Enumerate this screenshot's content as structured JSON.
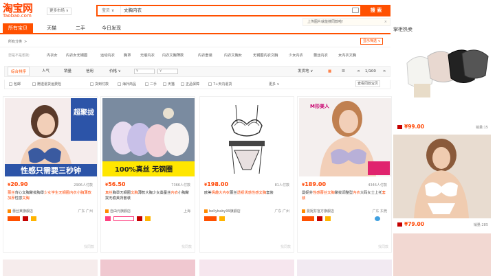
{
  "logo": {
    "cn": "淘宝网",
    "en": "Taobao.com"
  },
  "region": {
    "label": "更多市场 ∨"
  },
  "search": {
    "scope": "宝贝 ∨",
    "query": "文胸内衣",
    "button": "搜 索"
  },
  "tip": {
    "text": "上传图片就能搜同款啦!",
    "close": "×"
  },
  "nav": {
    "items": [
      {
        "label": "所有宝贝"
      },
      {
        "label": "天猫"
      },
      {
        "label": "二手"
      },
      {
        "label": "今日发现"
      }
    ]
  },
  "rightcol": {
    "title": "掌柜热卖"
  },
  "crumb": {
    "label": "所有分类",
    "arrow": ">"
  },
  "filter_button": "显示筛选 ∨",
  "attrs": {
    "label": "您是不是想找:",
    "items": [
      "内衣女",
      "内衣女无钢圈",
      "运动内衣",
      "胸罩",
      "无痕内衣",
      "内衣文胸薄款",
      "内衣套装",
      "内衣文胸女",
      "无钢圈内衣文胸",
      "少女内衣",
      "蕾丝内衣",
      "女内衣文胸"
    ]
  },
  "sortbar": {
    "items": [
      "综合排序",
      "人气",
      "销量",
      "信用",
      "价格 ∨"
    ],
    "price_from": "¥",
    "price_to": "¥",
    "ship_to": "发货地 ∨",
    "page": "1/100",
    "grid_icon": "▦",
    "list_icon": "☰",
    "prev": "<",
    "next": ">"
  },
  "checks": {
    "items": [
      "包邮",
      "赠送退货运费险",
      "货到付款",
      "海外商品",
      "二手",
      "天猫",
      "正品保障",
      "7+天内退货"
    ],
    "more": "更多 ∨",
    "global": "查看同款宝贝"
  },
  "products": [
    {
      "banner_top": "超聚拢",
      "banner_bottom": "性感只需要三秒钟",
      "price": "20.90",
      "sales": "2906人付款",
      "title": [
        "蕾丝",
        "背心文胸聚拢胸罩",
        "少女学生无钢圈内衣小胸薄款加厚",
        "性感",
        "文胸"
      ],
      "shop": "蕾丝莱旗舰店",
      "loc": "广东 广州",
      "colors": [
        "#ffb8c8",
        "#cc3366"
      ]
    },
    {
      "banner_top": "",
      "banner_bottom": "100%真丝 无钢圈",
      "price": "56.50",
      "sales": "7366人付款",
      "title": [
        "真丝",
        "胸罩无钢圈",
        "文胸",
        "薄款大胸少女桑蚕丝",
        "内衣",
        "小胸聚拢无痕美背套装"
      ],
      "shop": "自由元旗舰店",
      "loc": "上海",
      "colors": [
        "#e8d8f0",
        "#a090c0"
      ]
    },
    {
      "banner_top": "",
      "banner_bottom": "",
      "price": "198.00",
      "sales": "81人付款",
      "title": [
        "欧美",
        "情趣大内衣",
        "蕾丝",
        "透视诱惑性感",
        "文胸",
        "套装"
      ],
      "shop": "bellybaby99旗舰店",
      "loc": "广东 广州",
      "colors": [
        "#ffffff",
        "#222222"
      ]
    },
    {
      "banner_top": "M形美人",
      "banner_bottom": "",
      "price": "189.00",
      "sales": "4346人付款",
      "title": [
        "曼妮芬",
        "性感蕾丝",
        "文胸",
        "聚拢调整型",
        "内衣",
        "大码女士上托",
        "套装"
      ],
      "shop": "曼妮芬官方旗舰店",
      "loc": "广东 东莞",
      "colors": [
        "#f0e8ff",
        "#8a7ab0"
      ]
    }
  ],
  "right_products": [
    {
      "price": "99.00",
      "sales": "15"
    },
    {
      "price": "79.00",
      "sales": "285"
    }
  ],
  "labels": {
    "yen": "¥",
    "sales_prefix": "销量:",
    "corner": "找同款"
  }
}
